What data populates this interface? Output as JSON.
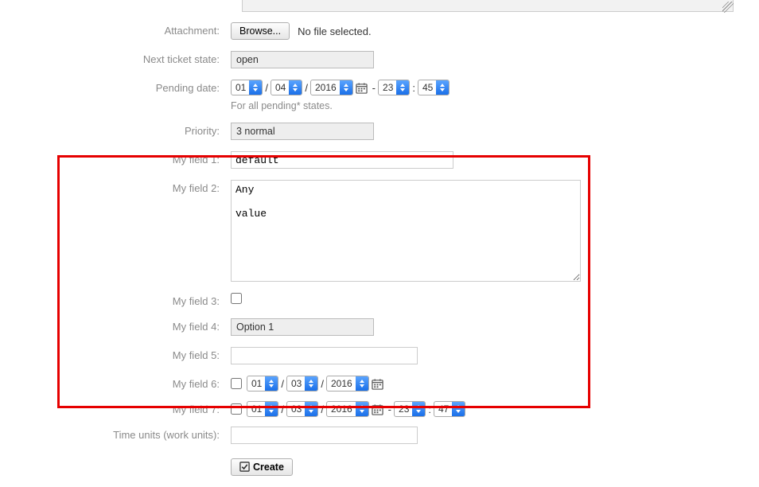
{
  "top_textarea_value": "",
  "labels": {
    "attachment": "Attachment:",
    "next_state": "Next ticket state:",
    "pending_date": "Pending date:",
    "priority": "Priority:",
    "field1": "My field 1:",
    "field2": "My field 2:",
    "field3": "My field 3:",
    "field4": "My field 4:",
    "field5": "My field 5:",
    "field6": "My field 6:",
    "field7": "My field 7:",
    "time_units": "Time units (work units):"
  },
  "attachment": {
    "browse_label": "Browse...",
    "status_text": "No file selected."
  },
  "next_state": {
    "value": "open"
  },
  "pending_date": {
    "day": "01",
    "month": "04",
    "year": "2016",
    "hour": "23",
    "minute": "45",
    "hint": "For all pending* states.",
    "slash": "/",
    "dash": "-",
    "colon": ":"
  },
  "priority": {
    "value": "3 normal"
  },
  "field1": {
    "value": "default"
  },
  "field2": {
    "value": "Any\n\nvalue"
  },
  "field3": {
    "checked": false
  },
  "field4": {
    "value": "Option 1"
  },
  "field5": {
    "value": ""
  },
  "field6": {
    "enabled": false,
    "day": "01",
    "month": "03",
    "year": "2016",
    "slash": "/"
  },
  "field7": {
    "enabled": false,
    "day": "01",
    "month": "03",
    "year": "2016",
    "hour": "23",
    "minute": "47",
    "slash": "/",
    "dash": "-",
    "colon": ":"
  },
  "time_units": {
    "value": ""
  },
  "create": {
    "label": "Create"
  }
}
